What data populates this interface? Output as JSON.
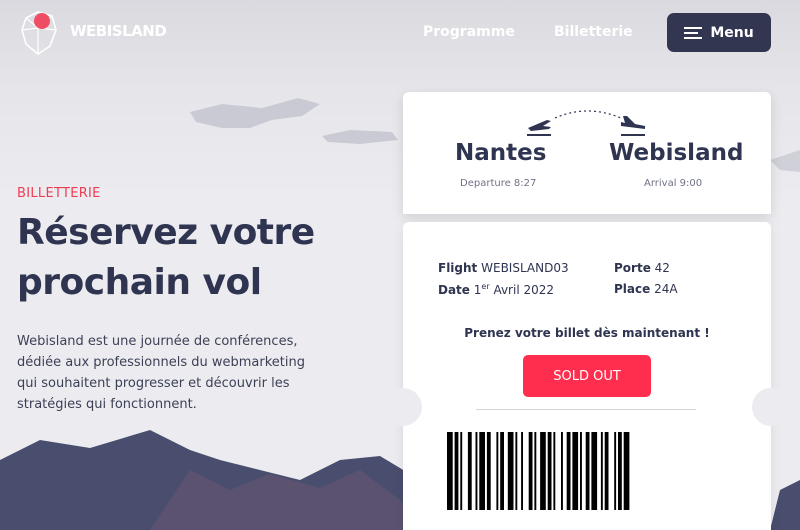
{
  "header": {
    "logo_text": "WEBISLAND",
    "nav": [
      {
        "label": "Programme"
      },
      {
        "label": "Billetterie"
      }
    ],
    "menu_label": "Menu"
  },
  "hero": {
    "eyebrow": "BILLETTERIE",
    "title_line1": "Réservez votre",
    "title_line2": "prochain vol",
    "description": "Webisland est une journée de conférences, dédiée aux professionnels du webmarketing qui souhaitent progresser et découvrir les stratégies qui fonctionnent."
  },
  "ticket": {
    "from_city": "Nantes",
    "to_city": "Webisland",
    "departure": "Departure 8:27",
    "arrival": "Arrival 9:00",
    "flight_label": "Flight",
    "flight_value": "WEBISLAND03",
    "date_label": "Date",
    "date_day": "1",
    "date_suffix": "er",
    "date_rest": "Avril 2022",
    "porte_label": "Porte",
    "porte_value": "42",
    "place_label": "Place",
    "place_value": "24A",
    "cta_text": "Prenez votre billet dès maintenant !",
    "button_label": "SOLD OUT"
  },
  "colors": {
    "accent": "#ff2e4f",
    "navy": "#323650",
    "eyebrow": "#ef3d55"
  }
}
